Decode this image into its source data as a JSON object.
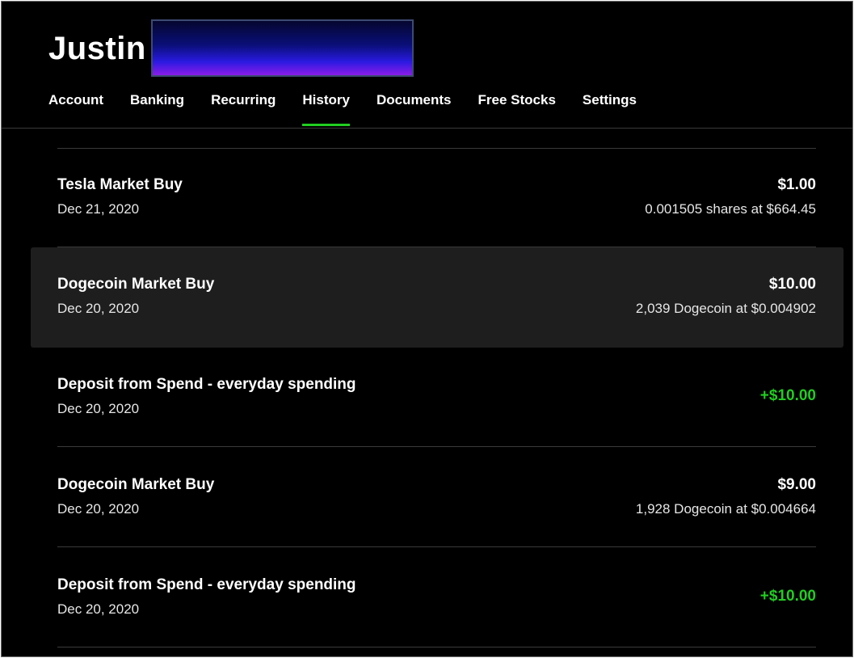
{
  "header": {
    "user_name": "Justin"
  },
  "tabs": [
    {
      "label": "Account"
    },
    {
      "label": "Banking"
    },
    {
      "label": "Recurring"
    },
    {
      "label": "History"
    },
    {
      "label": "Documents"
    },
    {
      "label": "Free Stocks"
    },
    {
      "label": "Settings"
    }
  ],
  "active_tab": "History",
  "colors": {
    "accent_green": "#21ce21",
    "background": "#000000",
    "row_highlight": "#1e1e1e"
  },
  "history": [
    {
      "title": "Tesla Market Buy",
      "date": "Dec 21, 2020",
      "amount": "$1.00",
      "detail": "0.001505 shares at $664.45"
    },
    {
      "title": "Dogecoin Market Buy",
      "date": "Dec 20, 2020",
      "amount": "$10.00",
      "detail": "2,039 Dogecoin at $0.004902"
    },
    {
      "title": "Deposit from Spend - everyday spending",
      "date": "Dec 20, 2020",
      "amount": "+$10.00",
      "detail": ""
    },
    {
      "title": "Dogecoin Market Buy",
      "date": "Dec 20, 2020",
      "amount": "$9.00",
      "detail": "1,928 Dogecoin at $0.004664"
    },
    {
      "title": "Deposit from Spend - everyday spending",
      "date": "Dec 20, 2020",
      "amount": "+$10.00",
      "detail": ""
    }
  ]
}
